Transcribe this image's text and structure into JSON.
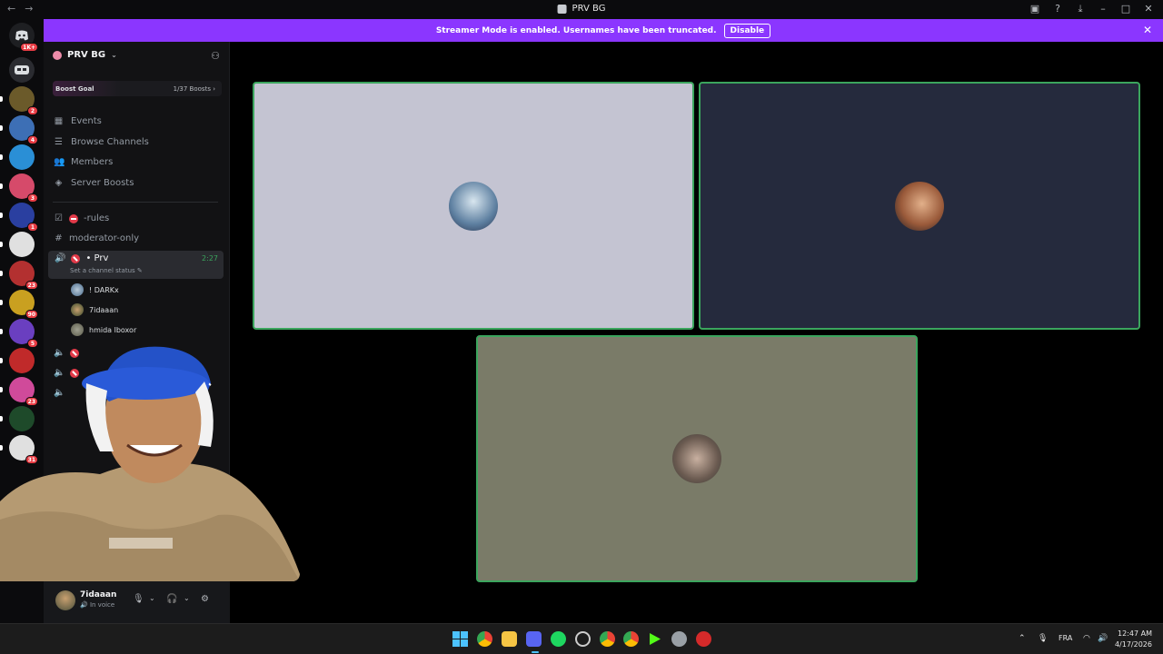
{
  "window": {
    "title": "PRV BG"
  },
  "banner": {
    "text": "Streamer Mode is enabled. Usernames have been truncated.",
    "action": "Disable"
  },
  "rail": {
    "home_badge": "1K+",
    "servers": [
      {
        "name": "server-1",
        "badge": "2",
        "color": "#6b5a2a"
      },
      {
        "name": "server-2",
        "badge": "4",
        "color": "#3d6fb5"
      },
      {
        "name": "server-3",
        "badge": "",
        "color": "#2a8fd6"
      },
      {
        "name": "server-4",
        "badge": "3",
        "color": "#d64a6a"
      },
      {
        "name": "server-5",
        "badge": "1",
        "color": "#2a3fa0"
      },
      {
        "name": "server-6",
        "badge": "",
        "color": "#e0e0e0"
      },
      {
        "name": "server-7",
        "badge": "23",
        "color": "#b33030"
      },
      {
        "name": "server-8",
        "badge": "90",
        "color": "#c9a020"
      },
      {
        "name": "server-9",
        "badge": "5",
        "color": "#6a3fc0"
      },
      {
        "name": "server-10",
        "badge": "",
        "color": "#c02a2a"
      },
      {
        "name": "server-11",
        "badge": "23",
        "color": "#d04a9a"
      },
      {
        "name": "server-12",
        "badge": "",
        "color": "#1e4a2a"
      },
      {
        "name": "server-13",
        "badge": "31",
        "color": "#e0e0e0"
      }
    ]
  },
  "sidebar": {
    "server_name": "PRV BG",
    "boost": {
      "label": "Boost Goal",
      "count": "1/37 Boosts"
    },
    "nav": [
      {
        "label": "Events",
        "icon": "calendar-icon"
      },
      {
        "label": "Browse Channels",
        "icon": "browse-icon"
      },
      {
        "label": "Members",
        "icon": "members-icon"
      },
      {
        "label": "Server Boosts",
        "icon": "boost-icon"
      }
    ],
    "channels": {
      "rules": "-rules",
      "moderator": "moderator-only"
    },
    "voice": {
      "name": "• Prv",
      "status": "Set a channel status",
      "timer": "2:27",
      "members": [
        "! DARKx",
        "7idaaan",
        "hmida lboxor"
      ]
    }
  },
  "user": {
    "name": "7idaaan",
    "status": "In voice"
  },
  "stage": {
    "tiles": [
      {
        "name": "tile-1",
        "bg": "#c4c4d2"
      },
      {
        "name": "tile-2",
        "bg": "#252a3d"
      },
      {
        "name": "tile-3",
        "bg": "#7a7b68"
      }
    ]
  },
  "tray": {
    "lang": "FRA",
    "time": "12:47 AM",
    "date": "4/17/2026"
  }
}
